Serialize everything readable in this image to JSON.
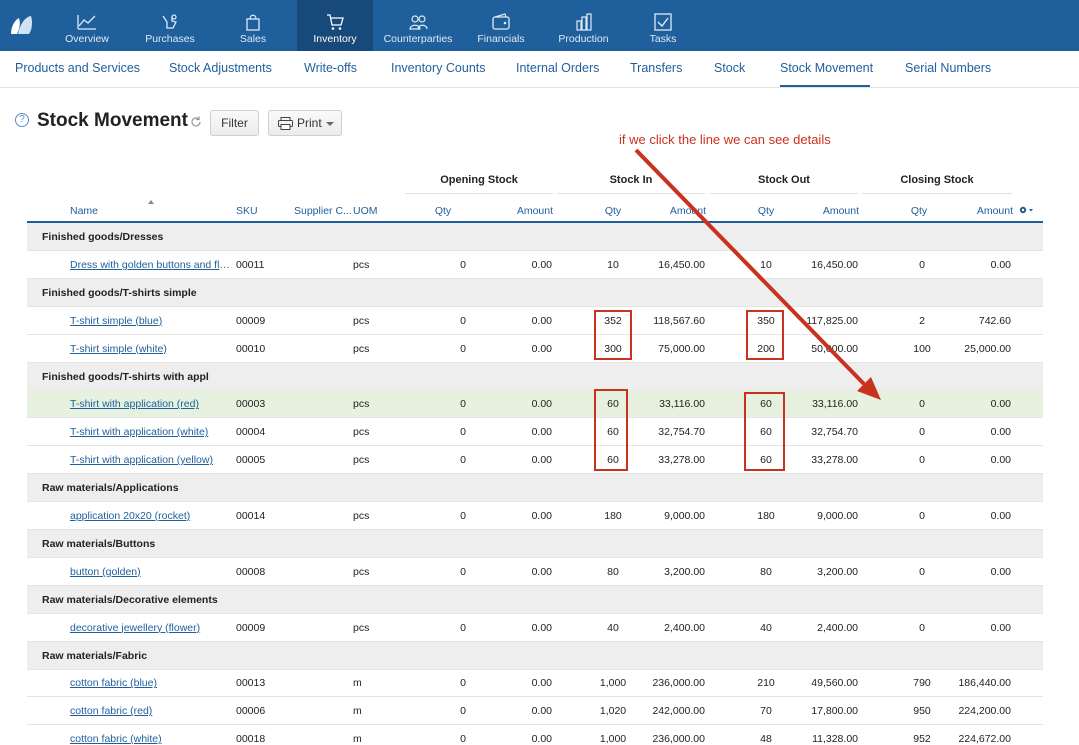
{
  "top_nav": {
    "items": [
      {
        "label": "Overview",
        "icon": "chart-icon"
      },
      {
        "label": "Purchases",
        "icon": "hand-icon"
      },
      {
        "label": "Sales",
        "icon": "shopping-bag-icon"
      },
      {
        "label": "Inventory",
        "icon": "cart-icon",
        "active": true
      },
      {
        "label": "Counterparties",
        "icon": "people-icon"
      },
      {
        "label": "Financials",
        "icon": "wallet-icon"
      },
      {
        "label": "Production",
        "icon": "factory-icon"
      },
      {
        "label": "Tasks",
        "icon": "checkbox-icon"
      }
    ],
    "background": "#1f5f9c",
    "active_background": "#17497a"
  },
  "sub_nav": {
    "items": [
      {
        "label": "Products and Services"
      },
      {
        "label": "Stock Adjustments"
      },
      {
        "label": "Write-offs"
      },
      {
        "label": "Inventory Counts"
      },
      {
        "label": "Internal Orders"
      },
      {
        "label": "Transfers"
      },
      {
        "label": "Stock"
      },
      {
        "label": "Stock Movement",
        "active": true
      },
      {
        "label": "Serial Numbers"
      }
    ]
  },
  "page": {
    "help_symbol": "?",
    "title": "Stock Movement",
    "filter_label": "Filter",
    "print_label": "Print"
  },
  "annotation": {
    "text": "if we click the line we can see details",
    "color": "#c8321e"
  },
  "table": {
    "group_headers": [
      "Opening Stock",
      "Stock In",
      "Stock Out",
      "Closing Stock"
    ],
    "columns": [
      "Name",
      "SKU",
      "Supplier C...",
      "UOM",
      "Qty",
      "Amount",
      "Qty",
      "Amount",
      "Qty",
      "Amount",
      "Qty",
      "Amount"
    ],
    "rows": [
      {
        "group": "Finished goods/Dresses"
      },
      {
        "name": "Dress with golden buttons and flo...",
        "sku": "00011",
        "uom": "pcs",
        "open_qty": "0",
        "open_amt": "0.00",
        "in_qty": "10",
        "in_amt": "16,450.00",
        "out_qty": "10",
        "out_amt": "16,450.00",
        "close_qty": "0",
        "close_amt": "0.00"
      },
      {
        "group": "Finished goods/T-shirts simple"
      },
      {
        "name": "T-shirt simple (blue)",
        "sku": "00009",
        "uom": "pcs",
        "open_qty": "0",
        "open_amt": "0.00",
        "in_qty": "352",
        "in_amt": "118,567.60",
        "out_qty": "350",
        "out_amt": "117,825.00",
        "close_qty": "2",
        "close_amt": "742.60"
      },
      {
        "name": "T-shirt simple (white)",
        "sku": "00010",
        "uom": "pcs",
        "open_qty": "0",
        "open_amt": "0.00",
        "in_qty": "300",
        "in_amt": "75,000.00",
        "out_qty": "200",
        "out_amt": "50,000.00",
        "close_qty": "100",
        "close_amt": "25,000.00"
      },
      {
        "group": "Finished goods/T-shirts with appl"
      },
      {
        "name": "T-shirt with application (red)",
        "sku": "00003",
        "uom": "pcs",
        "open_qty": "0",
        "open_amt": "0.00",
        "in_qty": "60",
        "in_amt": "33,116.00",
        "out_qty": "60",
        "out_amt": "33,116.00",
        "close_qty": "0",
        "close_amt": "0.00",
        "highlight": true
      },
      {
        "name": "T-shirt with application (white)",
        "sku": "00004",
        "uom": "pcs",
        "open_qty": "0",
        "open_amt": "0.00",
        "in_qty": "60",
        "in_amt": "32,754.70",
        "out_qty": "60",
        "out_amt": "32,754.70",
        "close_qty": "0",
        "close_amt": "0.00"
      },
      {
        "name": "T-shirt with application (yellow)",
        "sku": "00005",
        "uom": "pcs",
        "open_qty": "0",
        "open_amt": "0.00",
        "in_qty": "60",
        "in_amt": "33,278.00",
        "out_qty": "60",
        "out_amt": "33,278.00",
        "close_qty": "0",
        "close_amt": "0.00"
      },
      {
        "group": "Raw materials/Applications"
      },
      {
        "name": "application 20x20 (rocket)",
        "sku": "00014",
        "uom": "pcs",
        "open_qty": "0",
        "open_amt": "0.00",
        "in_qty": "180",
        "in_amt": "9,000.00",
        "out_qty": "180",
        "out_amt": "9,000.00",
        "close_qty": "0",
        "close_amt": "0.00"
      },
      {
        "group": "Raw materials/Buttons"
      },
      {
        "name": "button (golden)",
        "sku": "00008",
        "uom": "pcs",
        "open_qty": "0",
        "open_amt": "0.00",
        "in_qty": "80",
        "in_amt": "3,200.00",
        "out_qty": "80",
        "out_amt": "3,200.00",
        "close_qty": "0",
        "close_amt": "0.00"
      },
      {
        "group": "Raw materials/Decorative elements"
      },
      {
        "name": "decorative jewellery (flower)",
        "sku": "00009",
        "uom": "pcs",
        "open_qty": "0",
        "open_amt": "0.00",
        "in_qty": "40",
        "in_amt": "2,400.00",
        "out_qty": "40",
        "out_amt": "2,400.00",
        "close_qty": "0",
        "close_amt": "0.00"
      },
      {
        "group": "Raw materials/Fabric"
      },
      {
        "name": "cotton fabric (blue)",
        "sku": "00013",
        "uom": "m",
        "open_qty": "0",
        "open_amt": "0.00",
        "in_qty": "1,000",
        "in_amt": "236,000.00",
        "out_qty": "210",
        "out_amt": "49,560.00",
        "close_qty": "790",
        "close_amt": "186,440.00"
      },
      {
        "name": "cotton fabric (red)",
        "sku": "00006",
        "uom": "m",
        "open_qty": "0",
        "open_amt": "0.00",
        "in_qty": "1,020",
        "in_amt": "242,000.00",
        "out_qty": "70",
        "out_amt": "17,800.00",
        "close_qty": "950",
        "close_amt": "224,200.00"
      },
      {
        "name": "cotton fabric (white)",
        "sku": "00018",
        "uom": "m",
        "open_qty": "0",
        "open_amt": "0.00",
        "in_qty": "1,000",
        "in_amt": "236,000.00",
        "out_qty": "48",
        "out_amt": "11,328.00",
        "close_qty": "952",
        "close_amt": "224,672.00"
      }
    ]
  }
}
